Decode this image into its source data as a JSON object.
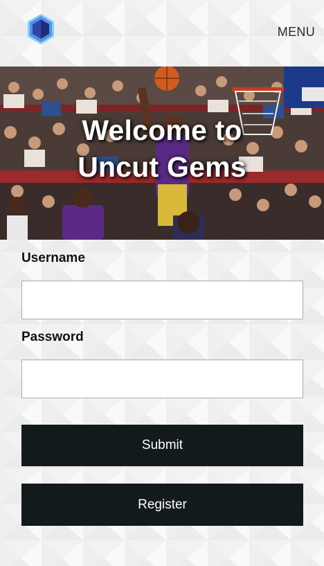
{
  "header": {
    "logo_icon": "hexagon-cube-logo",
    "menu_label": "MENU"
  },
  "hero": {
    "title_line1": "Welcome to",
    "title_line2": "Uncut Gems",
    "image_description_icon": "basketball-game-photo"
  },
  "form": {
    "username_label": "Username",
    "username_value": "",
    "password_label": "Password",
    "password_value": "",
    "submit_label": "Submit",
    "register_label": "Register"
  },
  "colors": {
    "button_bg": "#131a1c",
    "logo_light": "#7fd3f7",
    "logo_dark": "#2a3b8f",
    "logo_mid": "#4f6fd6"
  }
}
